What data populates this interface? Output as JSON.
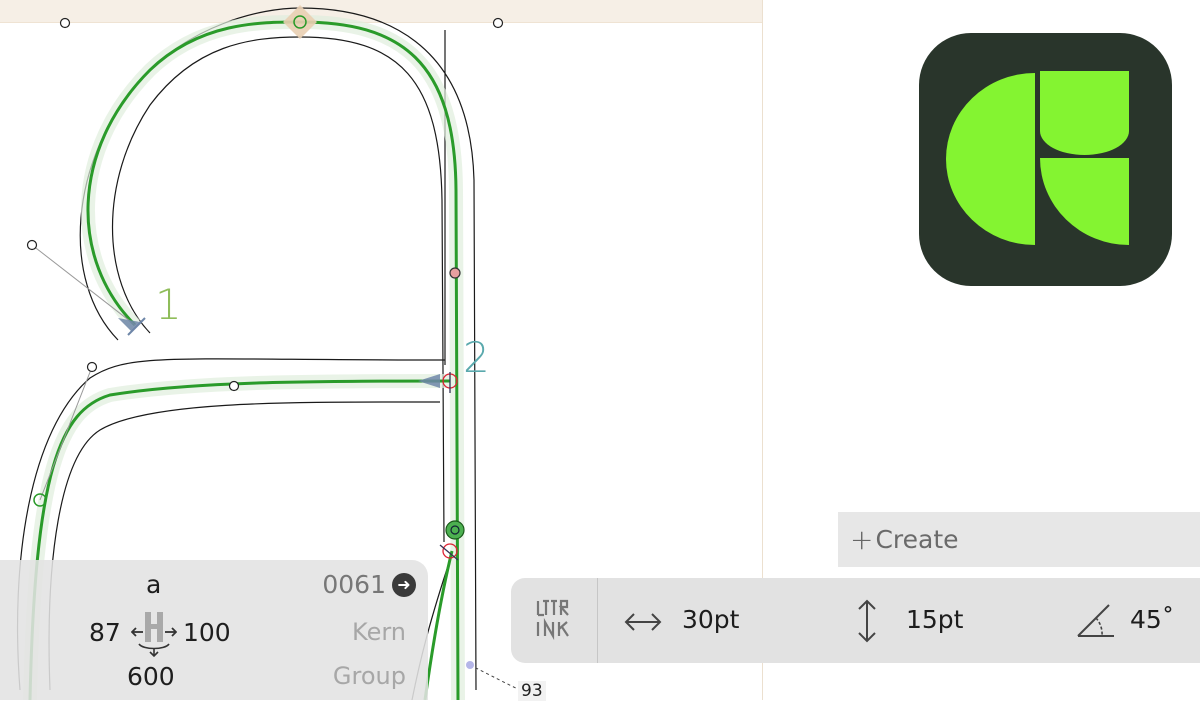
{
  "canvas": {
    "annotations": {
      "stroke_1": "1",
      "stroke_2": "2"
    },
    "distance_label": "93"
  },
  "create": {
    "label": "Create",
    "icon": "plus-icon"
  },
  "glyph_panel": {
    "glyph": "a",
    "unicode": "0061",
    "unicode_icon": "arrow-right-circle-icon",
    "left_sidebearing": "87",
    "right_sidebearing": "100",
    "advance_width": "600",
    "kern_label": "Kern",
    "group_label": "Group",
    "metrics_icon": "sidebearings-icon"
  },
  "brush_toolbar": {
    "logo": "lttr-ink-logo",
    "width": {
      "icon": "horizontal-arrows-icon",
      "value": "30pt"
    },
    "height": {
      "icon": "vertical-arrows-icon",
      "value": "15pt"
    },
    "angle": {
      "icon": "angle-icon",
      "value": "45˚"
    }
  },
  "app_icon": {
    "name": "app-icon",
    "background": "#29352b",
    "accent": "#84f431"
  },
  "colors": {
    "stroke_green": "#2a9b2a",
    "metric_band": "#f6efe6",
    "panel": "#e2e2e2"
  }
}
